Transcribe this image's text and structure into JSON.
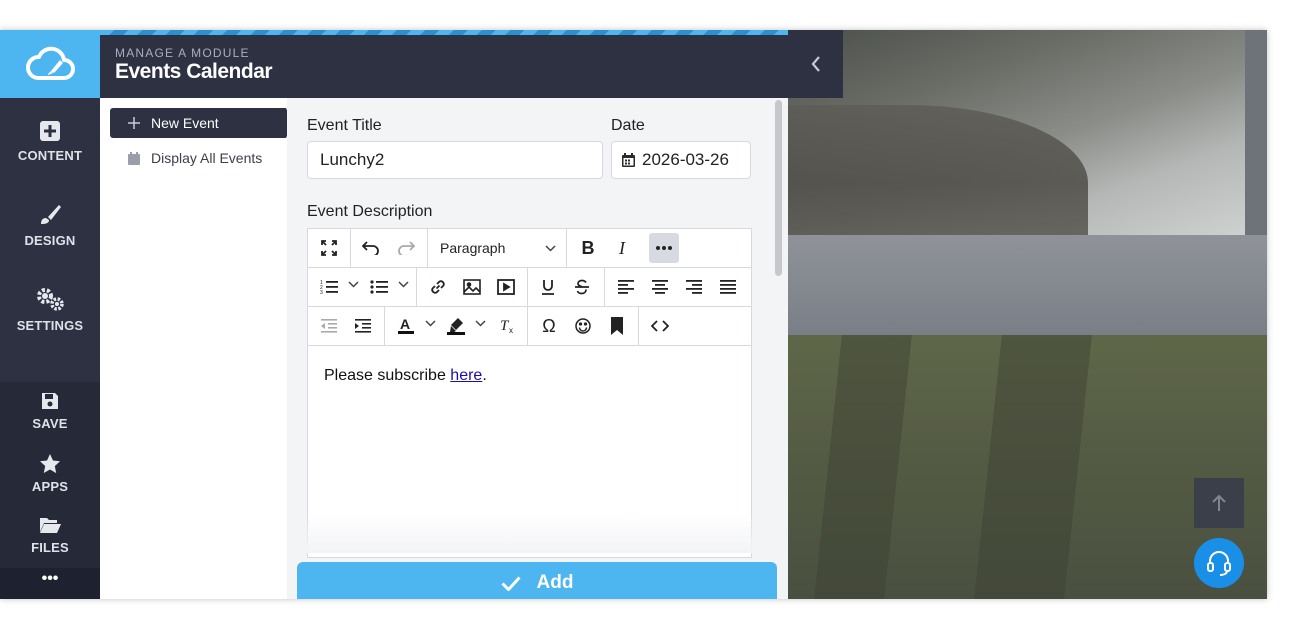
{
  "rail": {
    "items": [
      {
        "label": "CONTENT",
        "icon": "plus-square-icon"
      },
      {
        "label": "DESIGN",
        "icon": "brush-icon"
      },
      {
        "label": "SETTINGS",
        "icon": "gears-icon"
      },
      {
        "label": "SAVE",
        "icon": "floppy-disk-icon"
      },
      {
        "label": "APPS",
        "icon": "star-icon"
      },
      {
        "label": "FILES",
        "icon": "folder-open-icon"
      }
    ],
    "more": "•••"
  },
  "header": {
    "subtitle": "MANAGE A MODULE",
    "title": "Events Calendar"
  },
  "subnav": {
    "items": [
      {
        "label": "New Event",
        "icon": "plus-icon",
        "active": true
      },
      {
        "label": "Display All Events",
        "icon": "calendar-icon",
        "active": false
      }
    ]
  },
  "form": {
    "title_label": "Event Title",
    "title_value": "Lunchy2",
    "date_label": "Date",
    "date_value": "2026-03-26",
    "description_label": "Event Description"
  },
  "editor": {
    "block_format": "Paragraph",
    "content_text": "Please subscribe ",
    "content_link": "here",
    "content_end": "."
  },
  "add_button": "Add",
  "colors": {
    "accent": "#4db6f0",
    "dark": "#2d3142",
    "support": "#1a8fe8"
  }
}
